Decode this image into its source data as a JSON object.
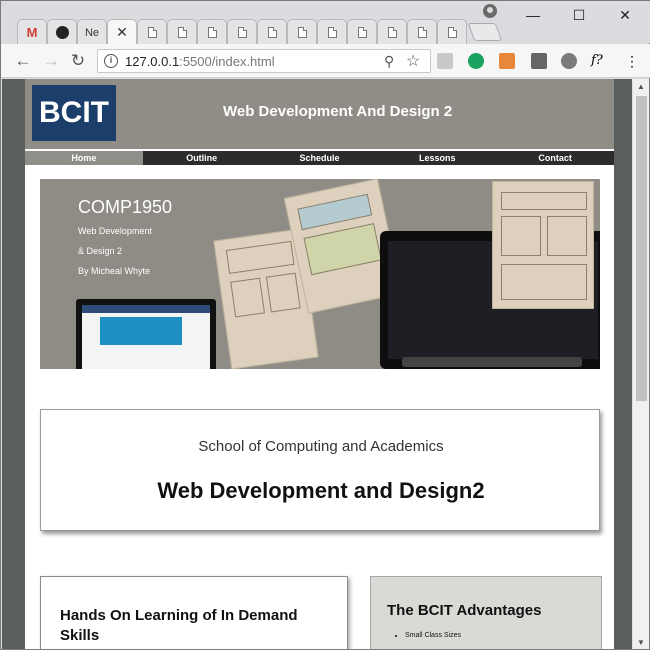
{
  "browser": {
    "tabs": [
      {
        "label": "",
        "icon": "gmail-icon"
      },
      {
        "label": "",
        "icon": "github-icon"
      },
      {
        "label": "Ne",
        "icon": "doc-icon"
      },
      {
        "label": "",
        "icon": "close-icon",
        "active": true
      },
      {
        "label": "",
        "icon": "doc-icon"
      }
    ],
    "url_host": "127.0.0.1",
    "url_rest": ":5500/index.html",
    "window_controls": {
      "minimize": "—",
      "maximize": "☐",
      "close": "✕"
    }
  },
  "site": {
    "logo": "BCIT",
    "title": "Web Development And Design 2",
    "nav": [
      "Home",
      "Outline",
      "Schedule",
      "Lessons",
      "Contact"
    ],
    "active_nav": "Home",
    "hero": {
      "course": "COMP1950",
      "line1": "Web Development",
      "line2": "& Design 2",
      "line3": "By Micheal Whyte"
    },
    "intro": {
      "subtitle": "School of Computing and Academics",
      "headline": "Web Development and Design2"
    },
    "card1_title": "Hands On Learning of In Demand Skills",
    "card2_title": "The BCIT Advantages",
    "card2_items": [
      "Small Class Sizes"
    ]
  },
  "colors": {
    "header_bg": "#8f8d86",
    "logo_bg": "#1c3e6a",
    "nav_bg": "#2c2c2c",
    "nav_active": "#908e88",
    "page_bg": "#5b5e5e"
  }
}
